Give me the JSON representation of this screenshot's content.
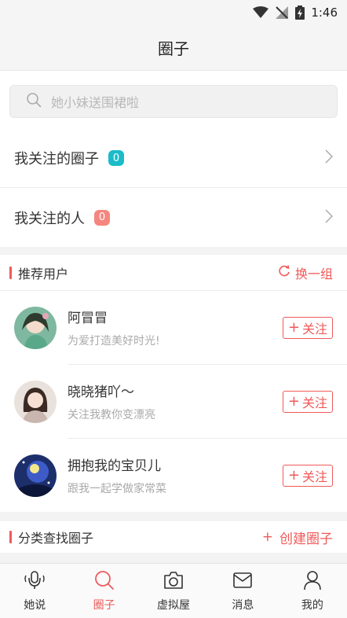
{
  "status_bar": {
    "time": "1:46"
  },
  "header": {
    "title": "圈子"
  },
  "search": {
    "placeholder": "她小妹送围裙啦"
  },
  "follow": {
    "circles": {
      "label": "我关注的圈子",
      "count": "0"
    },
    "people": {
      "label": "我关注的人",
      "count": "0"
    }
  },
  "recommended": {
    "title": "推荐用户",
    "refresh_label": "换一组",
    "follow_label": "关注",
    "users": [
      {
        "name": "阿冒冒",
        "bio": "为爱打造美好时光!"
      },
      {
        "name": "晓晓猪吖～",
        "bio": "关注我教你变漂亮"
      },
      {
        "name": "拥抱我的宝贝儿",
        "bio": "跟我一起学做家常菜"
      }
    ]
  },
  "categories": {
    "title": "分类查找圈子",
    "create_label": "创建圈子"
  },
  "tabs": [
    {
      "label": "她说",
      "icon": "mic-icon"
    },
    {
      "label": "圈子",
      "icon": "search-icon",
      "active": true
    },
    {
      "label": "虚拟屋",
      "icon": "camera-icon"
    },
    {
      "label": "消息",
      "icon": "mail-icon"
    },
    {
      "label": "我的",
      "icon": "person-icon"
    }
  ],
  "colors": {
    "accent": "#ef5a5a",
    "teal": "#1bbbc9",
    "pink_badge": "#f5867f"
  }
}
